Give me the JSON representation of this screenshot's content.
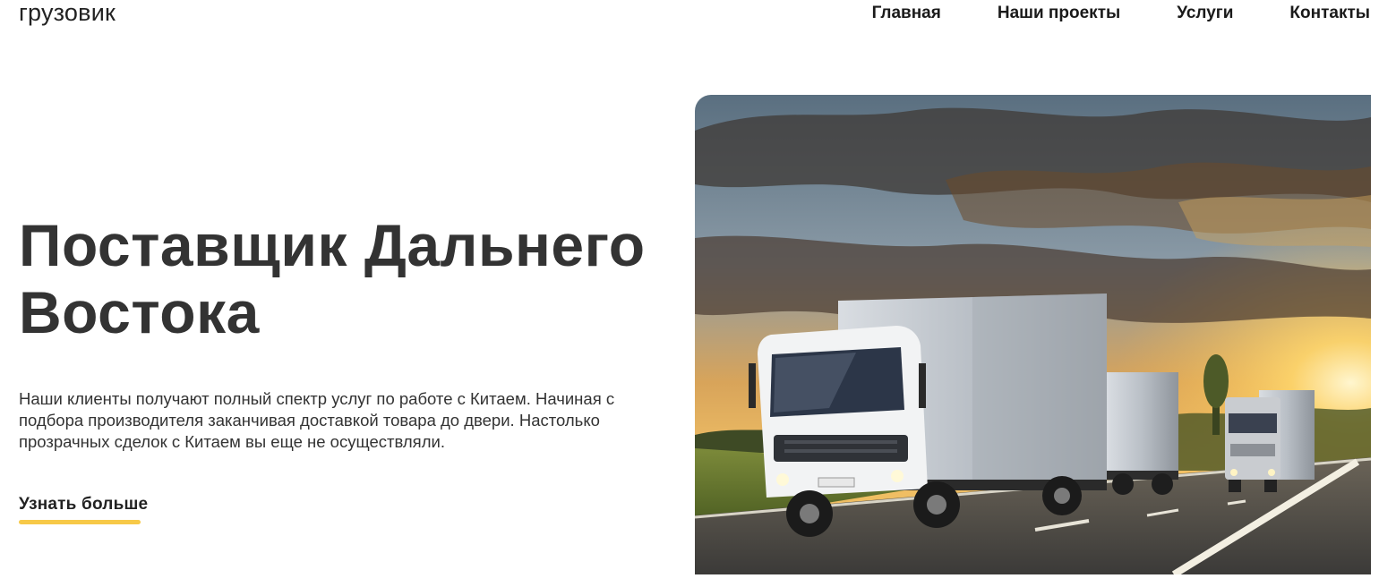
{
  "header": {
    "logo": "грузовик",
    "nav": [
      {
        "label": "Главная"
      },
      {
        "label": "Наши проекты"
      },
      {
        "label": "Услуги"
      },
      {
        "label": "Контакты"
      }
    ]
  },
  "hero": {
    "title": "Поставщик Дальнего Востока",
    "description": "Наши клиенты получают полный спектр услуг по работе с Китаем.  Начиная с\nподбора производителя заканчивая доставкой товара до двери.  Настолько\nпрозрачных сделок с Китаем вы еще не осуществляли.",
    "cta_label": "Узнать больше",
    "image_subject": "trucks-on-highway-at-sunset"
  },
  "colors": {
    "accent": "#f7c948",
    "text": "#333333",
    "nav_text": "#1a1a1a",
    "background": "#ffffff"
  }
}
